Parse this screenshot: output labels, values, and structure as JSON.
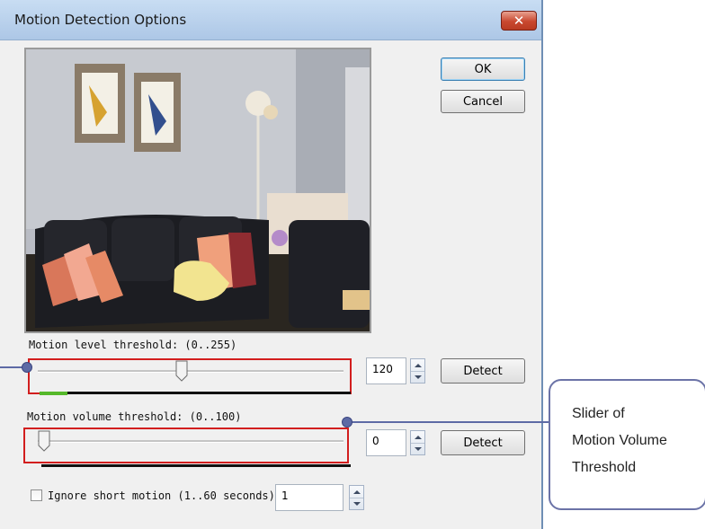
{
  "window": {
    "title": "Motion Detection Options",
    "close_glyph": "✕"
  },
  "preview": {
    "icon": "camera-preview-image"
  },
  "buttons": {
    "ok": "OK",
    "cancel": "Cancel"
  },
  "motion_level": {
    "label": "Motion level threshold: (0..255)",
    "value": "120",
    "slider_fraction": 0.47,
    "meter_fraction": 0.09,
    "meter_color": "#55b82a",
    "detect": "Detect"
  },
  "motion_volume": {
    "label": "Motion volume threshold: (0..100)",
    "value": "0",
    "slider_fraction": 0.0,
    "detect": "Detect"
  },
  "ignore_short_motion": {
    "label": "Ignore short motion (1..60 seconds)",
    "checked": false,
    "value": "1"
  },
  "callout": {
    "lines": [
      "Slider of",
      "Motion Volume",
      "Threshold"
    ]
  },
  "colors": {
    "annotation": "#5d6aa5",
    "highlight": "#d21e1e"
  }
}
